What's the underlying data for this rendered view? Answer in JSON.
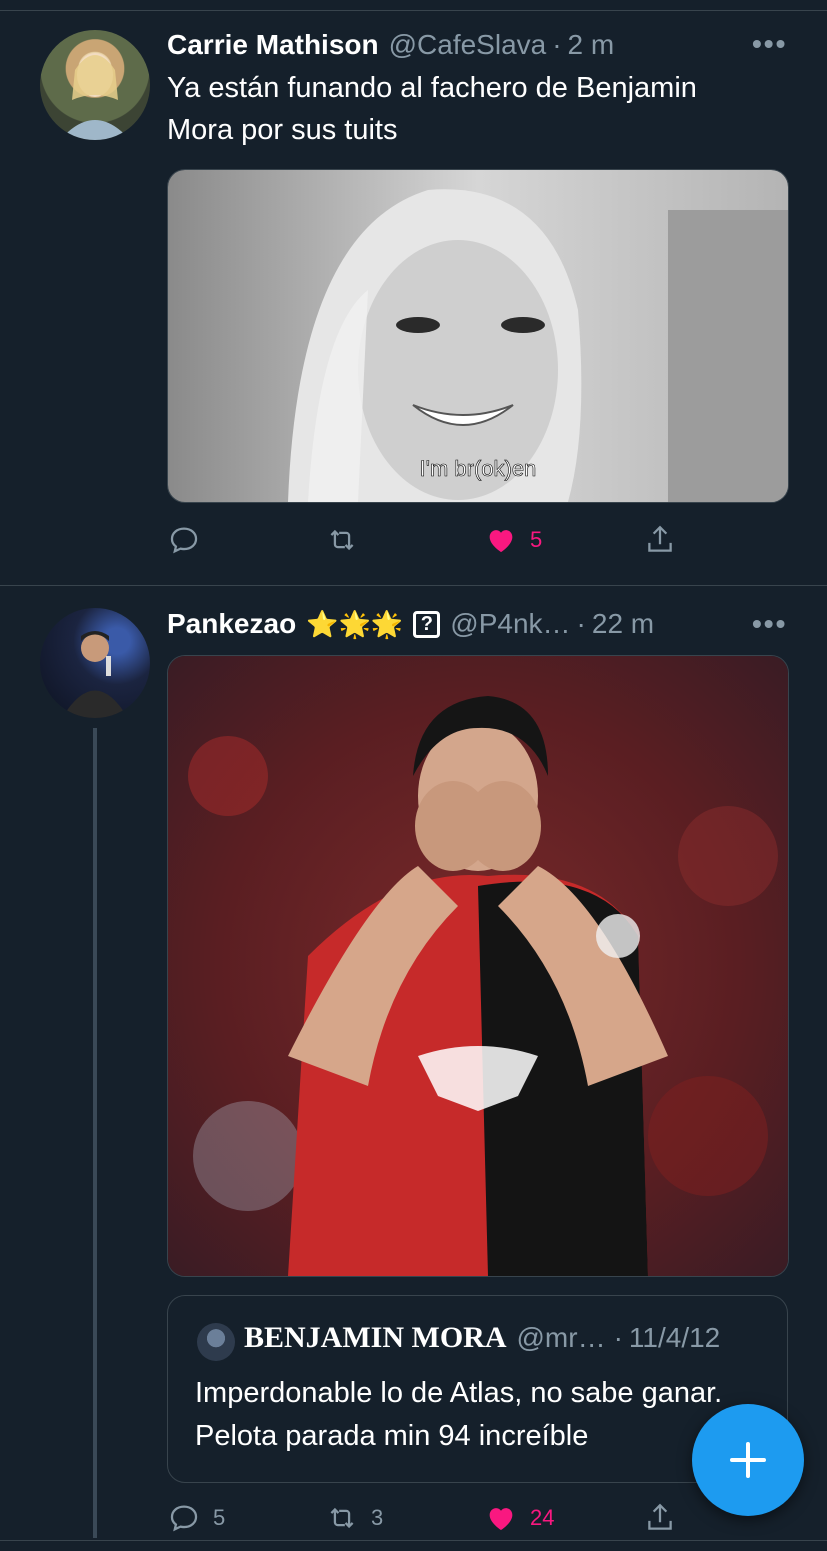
{
  "tweets": [
    {
      "name": "Carrie Mathison",
      "handle": "@CafeSlava",
      "dot": "·",
      "time": "2 m",
      "more": "•••",
      "text": "Ya están funando al fachero de Benjamin Mora por sus tuits",
      "media_caption": "I'm br(ok)en",
      "actions": {
        "reply_count": "",
        "retweet_count": "",
        "like_count": "5"
      }
    },
    {
      "name": "Pankezao",
      "emojis": "⭐🌟🌟",
      "badge": "?",
      "handle": "@P4nk…",
      "dot": "·",
      "time": "22 m",
      "more": "•••",
      "quote": {
        "name": "BENJAMIN MORA",
        "handle": "@mr…",
        "dot": "·",
        "date": "11/4/12",
        "text": "Imperdonable lo de Atlas, no sabe ganar. Pelota parada min 94 increíble"
      },
      "actions": {
        "reply_count": "5",
        "retweet_count": "3",
        "like_count": "24"
      }
    }
  ],
  "colors": {
    "background": "#15202b",
    "accent": "#1d9bf0",
    "like": "#f91880",
    "muted": "#8899a6"
  }
}
